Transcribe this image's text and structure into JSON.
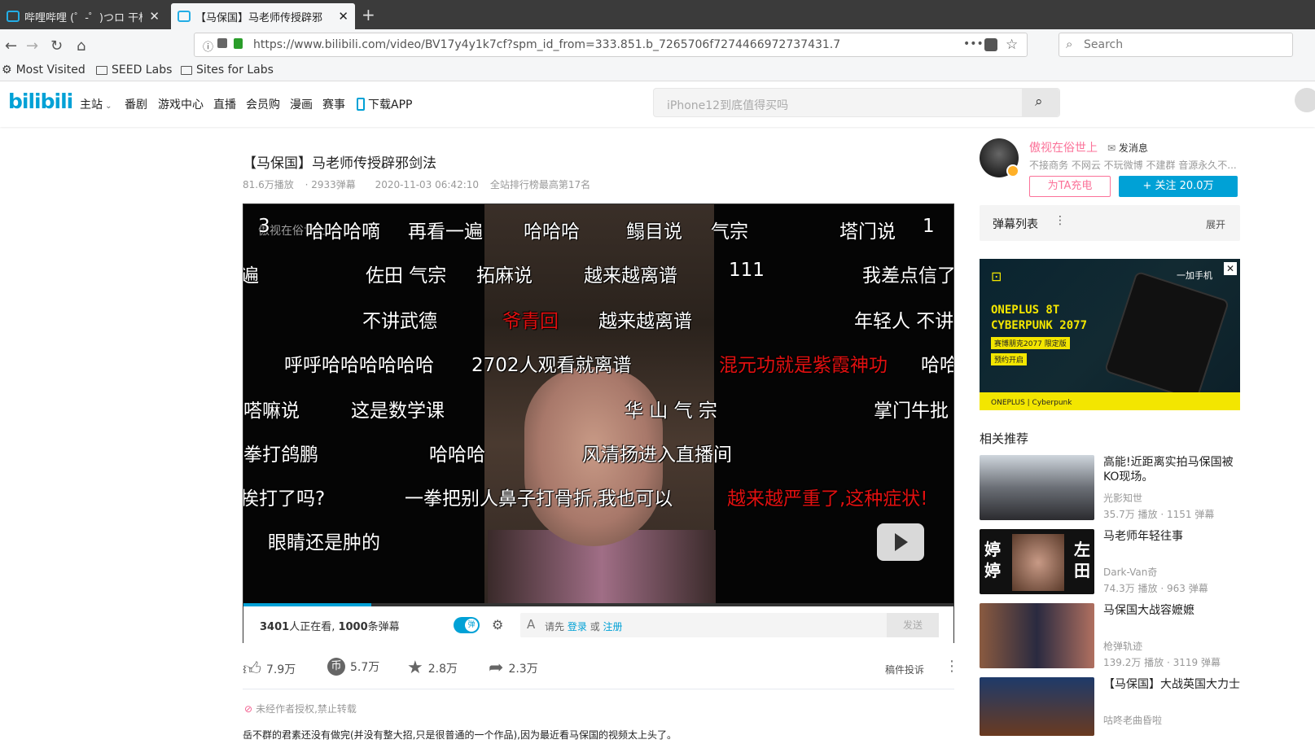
{
  "browser": {
    "tabs": [
      {
        "title": "哔哩哔哩 (゜-゜)つロ 干杯~-b",
        "active": false
      },
      {
        "title": "【马保国】马老师传授辟邪",
        "active": true
      }
    ],
    "url": "https://www.bilibili.com/video/BV17y4y1k7cf?spm_id_from=333.851.b_7265706f7274466972737431.7",
    "url_domain": "bilibili.com",
    "search_placeholder": "Search",
    "bookmarks": [
      "Most Visited",
      "SEED Labs",
      "Sites for Labs"
    ]
  },
  "site_header": {
    "logo": "bilibili",
    "nav": [
      "主站",
      "番剧",
      "游戏中心",
      "直播",
      "会员购",
      "漫画",
      "赛事",
      "下载APP"
    ],
    "search_placeholder": "iPhone12到底值得买吗"
  },
  "video": {
    "title": "【马保国】马老师传授辟邪剑法",
    "plays": "81.6万播放",
    "danmaku_count": "· 2933弹幕",
    "date": "2020-11-03 06:42:10",
    "rank": "全站排行榜最高第17名",
    "progress": 0.18,
    "watermark": "傲视在俗世上",
    "danmaku": [
      {
        "text": "3",
        "color": "#ffffff"
      },
      {
        "text": "哈哈哈嘀",
        "color": "#ffffff"
      },
      {
        "text": "再看一遍",
        "color": "#ffffff"
      },
      {
        "text": "哈哈哈",
        "color": "#ffffff"
      },
      {
        "text": "鳎目说",
        "color": "#ffffff"
      },
      {
        "text": "气宗",
        "color": "#ffffff"
      },
      {
        "text": "塔门说",
        "color": "#ffffff"
      },
      {
        "text": "1",
        "color": "#ffffff"
      },
      {
        "text": "遍",
        "color": "#ffffff"
      },
      {
        "text": "佐田 气宗",
        "color": "#ffffff"
      },
      {
        "text": "拓麻说",
        "color": "#ffffff"
      },
      {
        "text": "越来越离谱",
        "color": "#ffffff"
      },
      {
        "text": "111",
        "color": "#ffffff"
      },
      {
        "text": "我差点信了",
        "color": "#ffffff"
      },
      {
        "text": "不讲武德",
        "color": "#ffffff"
      },
      {
        "text": "爷青回",
        "color": "#e01010"
      },
      {
        "text": "越来越离谱",
        "color": "#ffffff"
      },
      {
        "text": "年轻人 不讲",
        "color": "#ffffff"
      },
      {
        "text": "呼呼哈哈哈哈哈哈",
        "color": "#ffffff"
      },
      {
        "text": "2702人观看就离谱",
        "color": "#ffffff"
      },
      {
        "text": "混元功就是紫霞神功",
        "color": "#e01010"
      },
      {
        "text": "哈哈",
        "color": "#ffffff"
      },
      {
        "text": "嗒嘛说",
        "color": "#ffffff"
      },
      {
        "text": "这是数学课",
        "color": "#ffffff"
      },
      {
        "text": "华 山 气 宗",
        "color": "#ffffff"
      },
      {
        "text": "掌门牛批",
        "color": "#ffffff"
      },
      {
        "text": "拳打鸽鹏",
        "color": "#ffffff"
      },
      {
        "text": "哈哈哈",
        "color": "#ffffff"
      },
      {
        "text": "风清扬进入直播间",
        "color": "#ffffff"
      },
      {
        "text": "挨打了吗?",
        "color": "#ffffff"
      },
      {
        "text": "一拳把别人鼻子打骨折,我也可以",
        "color": "#ffffff"
      },
      {
        "text": "越来越严重了,这种症状!",
        "color": "#e01010"
      },
      {
        "text": "眼睛还是肿的",
        "color": "#ffffff"
      }
    ],
    "controls": {
      "viewers_num": "3401",
      "viewers_text": "人正在看, ",
      "dm_num": "1000",
      "dm_text": "条弹幕",
      "toggle_label": "弹",
      "input_prefix": "请先",
      "login": "登录",
      "or": "或",
      "register": "注册",
      "send": "发送"
    },
    "actions": {
      "like": "7.9万",
      "coin": "5.7万",
      "fav": "2.8万",
      "share": "2.3万",
      "report": "稿件投诉"
    },
    "copyright": "未经作者授权,禁止转载",
    "desc": "岳不群的君素还没有做完(并没有整大招,只是很普通的一个作品),因为最近看马保国的视频太上头了。"
  },
  "uploader": {
    "name": "傲视在俗世上",
    "message": "发消息",
    "sign": "不接商务 不网云 不玩微博 不建群 音源永久不...",
    "charge": "为TA充电",
    "follow": "+  关注 20.0万"
  },
  "danmaku_list": {
    "title": "弹幕列表",
    "expand": "展开"
  },
  "ad": {
    "brand_cn": "一加手机",
    "line1": "ONEPLUS 8T",
    "line2": "CYBERPUNK 2077",
    "tag1": "赛博朋克2077 限定版",
    "tag2": "预约开启",
    "footer": "ONEPLUS | Cyberpunk"
  },
  "recommend": {
    "title": "相关推荐",
    "items": [
      {
        "title": "高能!近距离实拍马保国被KO现场。",
        "author": "光影知世",
        "stats": "35.7万 播放 · 1151 弹幕"
      },
      {
        "title": "马老师年轻往事",
        "author": "Dark-Van奇",
        "stats": "74.3万 播放 · 963 弹幕"
      },
      {
        "title": "马保国大战容嬷嬷",
        "author": "枪弹轨迹",
        "stats": "139.2万 播放 · 3119 弹幕"
      },
      {
        "title": "【马保国】大战英国大力士",
        "author": "咕咚老曲昏啦",
        "stats": ""
      }
    ]
  }
}
